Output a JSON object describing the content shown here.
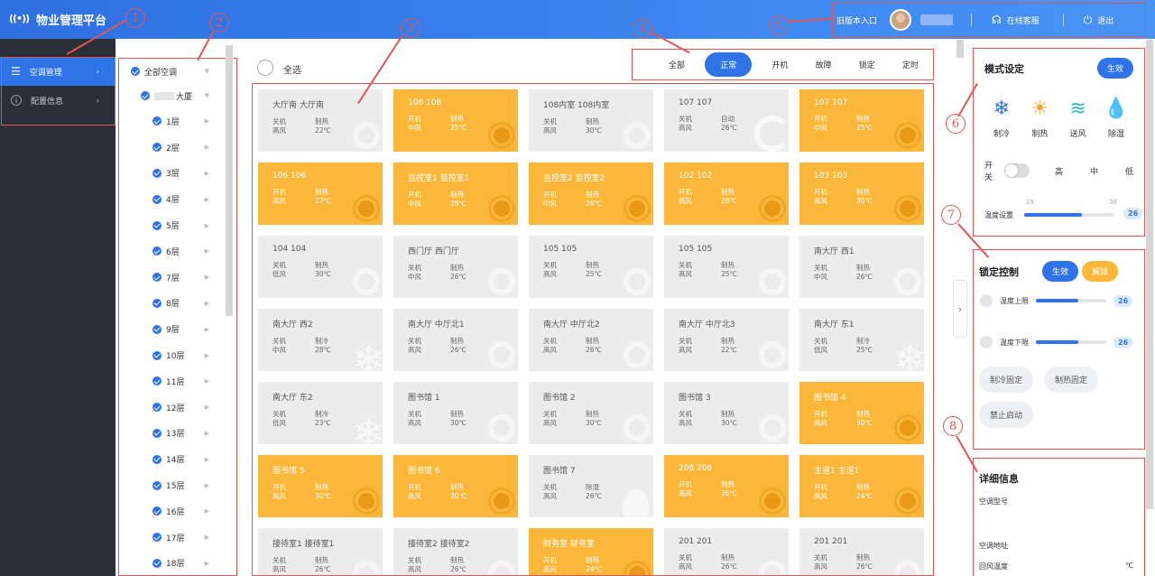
{
  "app": {
    "title": "物业管理平台"
  },
  "header": {
    "old_entry": "旧版本入口",
    "service": "在线客服",
    "logout": "退出"
  },
  "markers": [
    "1",
    "2",
    "3",
    "4",
    "5",
    "6",
    "7",
    "8"
  ],
  "nav": [
    {
      "label": "空调管理",
      "active": true
    },
    {
      "label": "配置信息",
      "active": false
    }
  ],
  "tree": {
    "root": "全部空调",
    "building": "大厦",
    "floors": [
      "1层",
      "2层",
      "3层",
      "4层",
      "5层",
      "6层",
      "7层",
      "8层",
      "9层",
      "10层",
      "11层",
      "12层",
      "13层",
      "14层",
      "15层",
      "16层",
      "17层",
      "18层"
    ]
  },
  "main": {
    "select_all": "全选",
    "filters": [
      {
        "label": "全部",
        "active": false
      },
      {
        "label": "正常",
        "active": true
      },
      {
        "label": "开机",
        "active": false
      },
      {
        "label": "故障",
        "active": false
      },
      {
        "label": "锁定",
        "active": false
      },
      {
        "label": "定时",
        "active": false
      }
    ],
    "cards": [
      {
        "name": "大厅南 大厅南",
        "power": "关机",
        "mode": "制热",
        "fan": "高风",
        "temp": "22℃",
        "on": false,
        "icon": "sun"
      },
      {
        "name": "108 108",
        "power": "开机",
        "mode": "制热",
        "fan": "中风",
        "temp": "25℃",
        "on": true,
        "icon": "sun"
      },
      {
        "name": "108内室 108内室",
        "power": "关机",
        "mode": "制热",
        "fan": "高风",
        "temp": "30℃",
        "on": false,
        "icon": "sun"
      },
      {
        "name": "107 107",
        "power": "关机",
        "mode": "自动",
        "fan": "高风",
        "temp": "26℃",
        "on": false,
        "icon": "cycle"
      },
      {
        "name": "107 107",
        "power": "开机",
        "mode": "制热",
        "fan": "中风",
        "temp": "25℃",
        "on": true,
        "icon": "sun"
      },
      {
        "name": "106 106",
        "power": "开机",
        "mode": "制热",
        "fan": "高风",
        "temp": "27℃",
        "on": true,
        "icon": "sun"
      },
      {
        "name": "监控室1 监控室1",
        "power": "开机",
        "mode": "制热",
        "fan": "中风",
        "temp": "28℃",
        "on": true,
        "icon": "sun"
      },
      {
        "name": "监控室2 监控室2",
        "power": "开机",
        "mode": "制热",
        "fan": "中风",
        "temp": "28℃",
        "on": true,
        "icon": "sun"
      },
      {
        "name": "102 102",
        "power": "开机",
        "mode": "制热",
        "fan": "高风",
        "temp": "28℃",
        "on": true,
        "icon": "sun"
      },
      {
        "name": "103 103",
        "power": "开机",
        "mode": "制热",
        "fan": "高风",
        "temp": "30℃",
        "on": true,
        "icon": "sun"
      },
      {
        "name": "104 104",
        "power": "关机",
        "mode": "制热",
        "fan": "低风",
        "temp": "30℃",
        "on": false,
        "icon": "sun"
      },
      {
        "name": "西门厅 西门厅",
        "power": "关机",
        "mode": "制热",
        "fan": "中风",
        "temp": "26℃",
        "on": false,
        "icon": "sun"
      },
      {
        "name": "105 105",
        "power": "关机",
        "mode": "制热",
        "fan": "高风",
        "temp": "25℃",
        "on": false,
        "icon": "sun"
      },
      {
        "name": "105 105",
        "power": "关机",
        "mode": "制热",
        "fan": "高风",
        "temp": "25℃",
        "on": false,
        "icon": "sun"
      },
      {
        "name": "南大厅 西1",
        "power": "关机",
        "mode": "制热",
        "fan": "中风",
        "temp": "26℃",
        "on": false,
        "icon": "sun"
      },
      {
        "name": "南大厅 西2",
        "power": "关机",
        "mode": "制冷",
        "fan": "中风",
        "temp": "28℃",
        "on": false,
        "icon": "snow"
      },
      {
        "name": "南大厅 中厅北1",
        "power": "关机",
        "mode": "制热",
        "fan": "高风",
        "temp": "26℃",
        "on": false,
        "icon": "sun"
      },
      {
        "name": "南大厅 中厅北2",
        "power": "关机",
        "mode": "制热",
        "fan": "高风",
        "temp": "26℃",
        "on": false,
        "icon": "sun"
      },
      {
        "name": "南大厅 中厅北3",
        "power": "关机",
        "mode": "制热",
        "fan": "高风",
        "temp": "22℃",
        "on": false,
        "icon": "sun"
      },
      {
        "name": "南大厅 东1",
        "power": "关机",
        "mode": "制冷",
        "fan": "低风",
        "temp": "25℃",
        "on": false,
        "icon": "snow"
      },
      {
        "name": "南大厅 东2",
        "power": "关机",
        "mode": "制冷",
        "fan": "低风",
        "temp": "23℃",
        "on": false,
        "icon": "snow"
      },
      {
        "name": "图书馆 1",
        "power": "关机",
        "mode": "制热",
        "fan": "高风",
        "temp": "30℃",
        "on": false,
        "icon": "sun"
      },
      {
        "name": "图书馆 2",
        "power": "关机",
        "mode": "制热",
        "fan": "高风",
        "temp": "30℃",
        "on": false,
        "icon": "sun"
      },
      {
        "name": "图书馆 3",
        "power": "关机",
        "mode": "制热",
        "fan": "高风",
        "temp": "30℃",
        "on": false,
        "icon": "sun"
      },
      {
        "name": "图书馆 4",
        "power": "开机",
        "mode": "制热",
        "fan": "高风",
        "temp": "30℃",
        "on": true,
        "icon": "sun"
      },
      {
        "name": "图书馆 5",
        "power": "开机",
        "mode": "制热",
        "fan": "高风",
        "temp": "30℃",
        "on": true,
        "icon": "sun"
      },
      {
        "name": "图书馆 6",
        "power": "开机",
        "mode": "制热",
        "fan": "高风",
        "temp": "30℃",
        "on": true,
        "icon": "sun"
      },
      {
        "name": "图书馆 7",
        "power": "关机",
        "mode": "除湿",
        "fan": "高风",
        "temp": "26℃",
        "on": false,
        "icon": "drop"
      },
      {
        "name": "208 208",
        "power": "开机",
        "mode": "制热",
        "fan": "高风",
        "temp": "26℃",
        "on": true,
        "icon": "sun"
      },
      {
        "name": "主道1 主道1",
        "power": "开机",
        "mode": "制热",
        "fan": "高风",
        "temp": "24℃",
        "on": true,
        "icon": "sun"
      },
      {
        "name": "接待室1 接待室1",
        "power": "关机",
        "mode": "制热",
        "fan": "高风",
        "temp": "26℃",
        "on": false,
        "icon": "sun"
      },
      {
        "name": "接待室2 接待室2",
        "power": "关机",
        "mode": "制热",
        "fan": "高风",
        "temp": "26℃",
        "on": false,
        "icon": "sun"
      },
      {
        "name": "财务室 财务室",
        "power": "开机",
        "mode": "制热",
        "fan": "高风",
        "temp": "24℃",
        "on": true,
        "icon": "sun"
      },
      {
        "name": "201 201",
        "power": "关机",
        "mode": "制热",
        "fan": "高风",
        "temp": "26℃",
        "on": false,
        "icon": "sun"
      },
      {
        "name": "201 201",
        "power": "关机",
        "mode": "制热",
        "fan": "高风",
        "temp": "26℃",
        "on": false,
        "icon": "sun"
      }
    ]
  },
  "mode_panel": {
    "title": "模式设定",
    "apply": "生效",
    "modes": [
      {
        "label": "制冷",
        "icon": "snowflake-icon",
        "glyph": "❄",
        "color": "#2f73e6"
      },
      {
        "label": "制热",
        "icon": "sun-icon",
        "glyph": "☀",
        "color": "#f5a623"
      },
      {
        "label": "送风",
        "icon": "wind-icon",
        "glyph": "≋",
        "color": "#2fb8c8"
      },
      {
        "label": "除湿",
        "icon": "droplet-icon",
        "glyph": "💧",
        "color": "#b07de8"
      }
    ],
    "switch_label": "开关",
    "fan_speeds": [
      "高",
      "中",
      "低"
    ],
    "temp_label": "温度设置",
    "temp_min": "19",
    "temp_max": "30",
    "temp_value": "26",
    "temp_fraction": 0.64
  },
  "lock_panel": {
    "title": "锁定控制",
    "apply": "生效",
    "release": "解除",
    "upper_label": "温度上限",
    "upper_value": "26",
    "upper_fraction": 0.6,
    "lower_label": "温度下限",
    "lower_value": "26",
    "lower_fraction": 0.6,
    "cool_fix": "制冷固定",
    "heat_fix": "制热固定",
    "forbid": "禁止启动"
  },
  "detail_panel": {
    "title": "详细信息",
    "model_label": "空调型号",
    "address_label": "空调地址",
    "return_temp_label": "回风温度",
    "return_temp_unit": "℃"
  },
  "colors": {
    "primary": "#2f73e6",
    "on": "#fbb73a",
    "off": "#ececec",
    "marker": "#e05555"
  }
}
